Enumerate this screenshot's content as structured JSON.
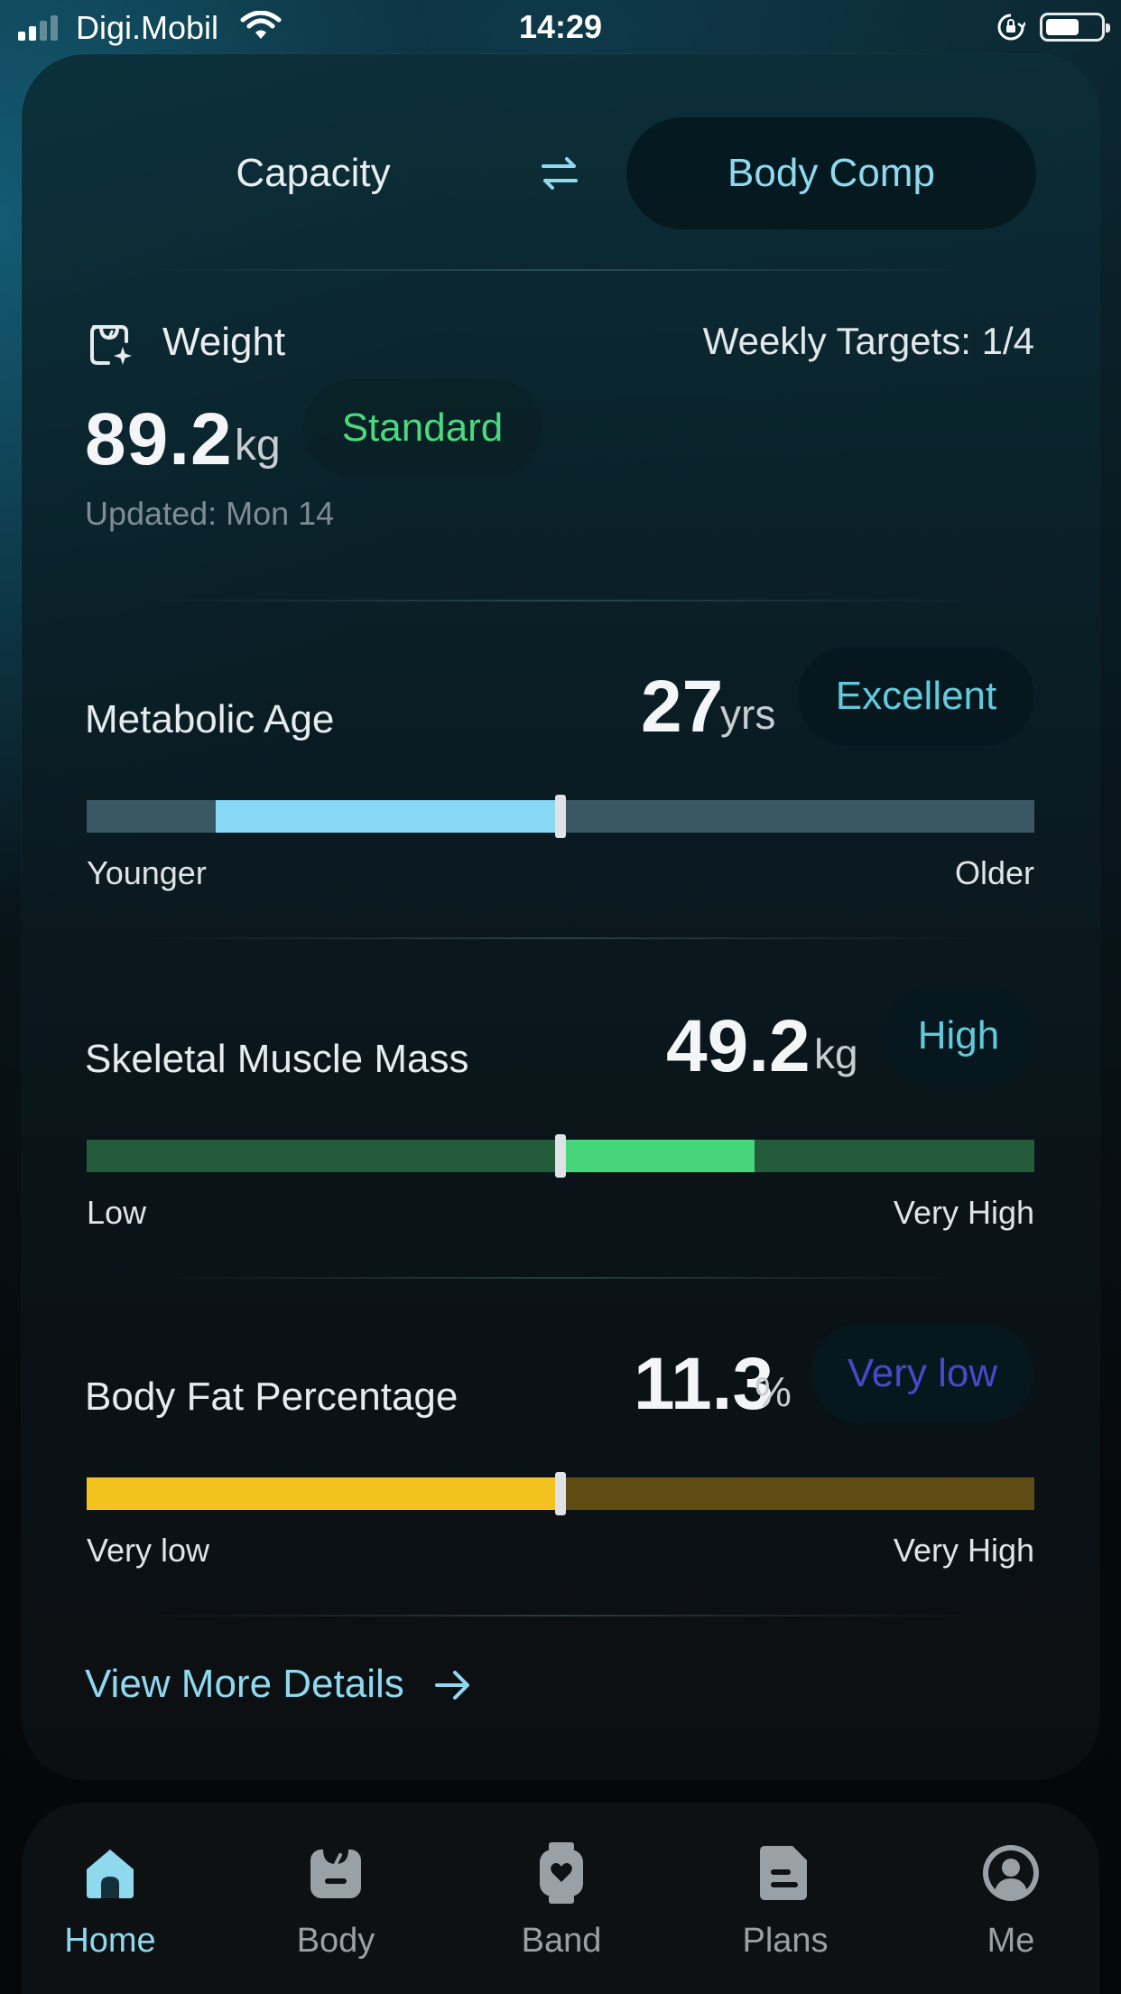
{
  "status_bar": {
    "carrier": "Digi.Mobil",
    "time": "14:29",
    "battery_level": 0.6
  },
  "header": {
    "tab_left": "Capacity",
    "tab_right": "Body Comp",
    "swap_icon": "swap-arrows-icon"
  },
  "weight": {
    "title": "Weight",
    "icon": "scale-sparkle-icon",
    "weekly_targets": "Weekly Targets: 1/4",
    "value": "89.2",
    "unit": "kg",
    "badge": "Standard",
    "updated": "Updated: Mon 14"
  },
  "metrics": [
    {
      "label": "Metabolic Age",
      "value": "27",
      "unit": "yrs",
      "badge": "Excellent",
      "badge_color": "#63c9dd",
      "low_label": "Younger",
      "high_label": "Older",
      "track_color": "#3a5864",
      "fill_color": "#86d8f5",
      "fill_start": 0.136,
      "marker_position": 0.5
    },
    {
      "label": "Skeletal Muscle Mass",
      "value": "49.2",
      "unit": "kg",
      "badge": "High",
      "badge_color": "#63c9dd",
      "low_label": "Low",
      "high_label": "Very High",
      "track_color": "#245b3b",
      "fill_color": "#46d57a",
      "fill_start": 0.5,
      "fill_end": 0.705,
      "marker_position": 0.5
    },
    {
      "label": "Body Fat Percentage",
      "value": "11.3",
      "unit": "%",
      "badge": "Very low",
      "badge_color": "#4a48c8",
      "low_label": "Very low",
      "high_label": "Very High",
      "track_color": "#5f4d14",
      "fill_color": "#f4c21c",
      "fill_start": 0.0,
      "marker_position": 0.5
    }
  ],
  "view_more": "View More Details",
  "nav": [
    {
      "label": "Home",
      "icon": "home-icon",
      "active": true
    },
    {
      "label": "Body",
      "icon": "body-scale-icon",
      "active": false
    },
    {
      "label": "Band",
      "icon": "band-watch-icon",
      "active": false
    },
    {
      "label": "Plans",
      "icon": "plans-document-icon",
      "active": false
    },
    {
      "label": "Me",
      "icon": "profile-icon",
      "active": false
    }
  ],
  "colors": {
    "accent": "#8fd9ef",
    "standard_green": "#4cd97e"
  }
}
